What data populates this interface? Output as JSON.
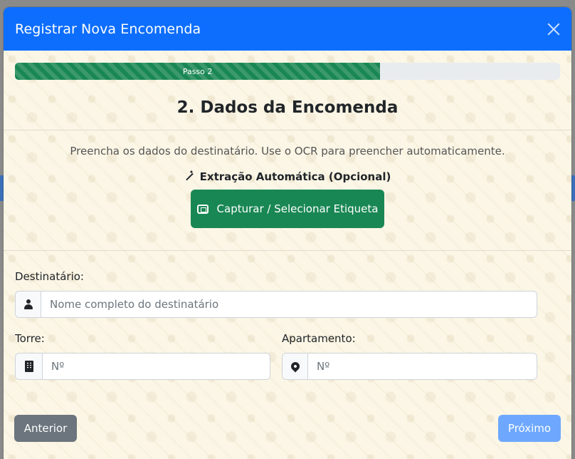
{
  "modal": {
    "title": "Registrar Nova Encomenda",
    "close_label": "Fechar"
  },
  "progress": {
    "label": "Passo 2",
    "value_percent": 67
  },
  "step": {
    "title": "2. Dados da Encomenda",
    "description": "Preencha os dados do destinatário. Use o OCR para preencher automaticamente."
  },
  "ocr": {
    "label": "Extração Automática (Opcional)",
    "button_label": "Capturar / Selecionar Etiqueta"
  },
  "form": {
    "recipient": {
      "label": "Destinatário:",
      "placeholder": "Nome completo do destinatário",
      "value": ""
    },
    "tower": {
      "label": "Torre:",
      "placeholder": "Nº",
      "value": ""
    },
    "apartment": {
      "label": "Apartamento:",
      "placeholder": "Nº",
      "value": ""
    }
  },
  "footer": {
    "prev_label": "Anterior",
    "next_label": "Próximo"
  },
  "colors": {
    "header": "#0d6efd",
    "progress": "#198754",
    "capture_button": "#198754",
    "prev_button": "#6c757d",
    "next_button": "#6ea8fe"
  },
  "icons": {
    "close": "close-icon",
    "ocr": "magic-wand-icon",
    "capture": "tag-icon",
    "recipient": "user-icon",
    "tower": "building-icon",
    "apartment": "map-pin-icon"
  }
}
